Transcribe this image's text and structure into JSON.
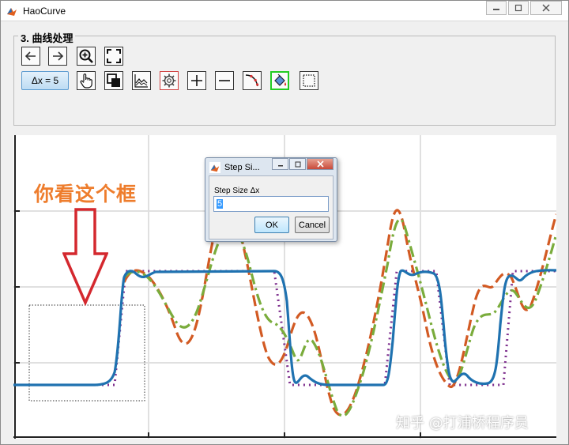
{
  "window": {
    "title": "HaoCurve",
    "minimize_icon": "minimize-icon",
    "maximize_icon": "maximize-icon",
    "close_icon": "close-icon"
  },
  "panel": {
    "title": "3. 曲线处理",
    "row1": [
      {
        "name": "back-arrow-icon"
      },
      {
        "name": "forward-arrow-icon"
      },
      {
        "name": "zoom-in-icon"
      },
      {
        "name": "fit-to-view-icon"
      }
    ],
    "step_button_label": "Δx = 5",
    "row2": [
      {
        "name": "hand-pointer-icon"
      },
      {
        "name": "copy-icon"
      },
      {
        "name": "curve-chart-icon"
      },
      {
        "name": "gear-icon"
      },
      {
        "name": "plus-icon"
      },
      {
        "name": "minus-icon"
      },
      {
        "name": "curve-edit-icon"
      },
      {
        "name": "paint-bucket-icon"
      },
      {
        "name": "selection-box-icon"
      }
    ]
  },
  "annotation": {
    "text": "你看这个框"
  },
  "watermark": "知乎 @打浦桥程序员",
  "dialog": {
    "title": "Step Si...",
    "label": "Step Size Δx",
    "input_value": "5",
    "ok_label": "OK",
    "cancel_label": "Cancel"
  },
  "colors": {
    "blue_curve": "#1f72b0",
    "orange_curve": "#d25a23",
    "green_curve": "#7aac3c",
    "purple_curve": "#7e2f8e",
    "arrow": "#d4282e",
    "annotation": "#ee7d2d"
  }
}
